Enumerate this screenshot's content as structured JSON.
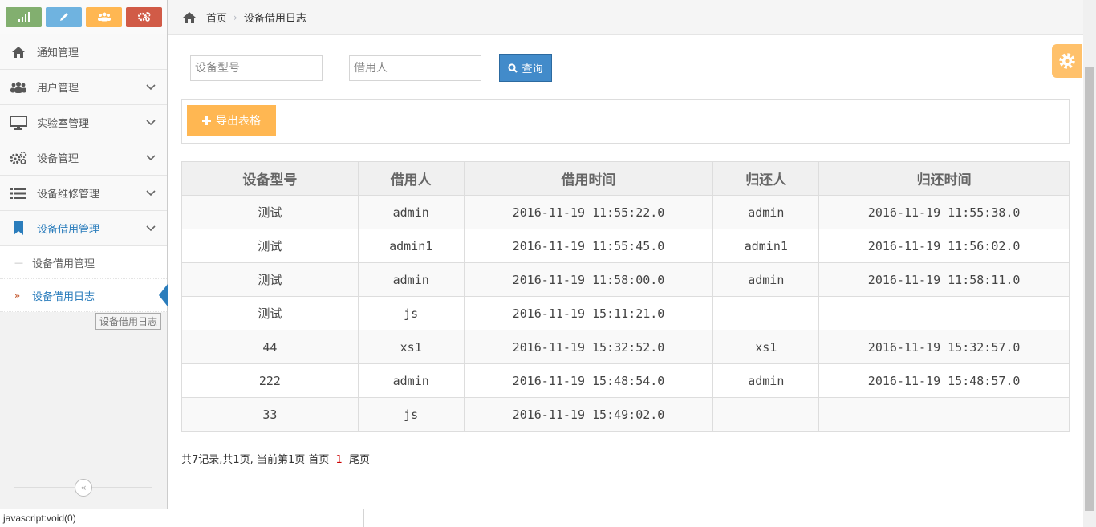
{
  "sidebar": {
    "shortcuts": [
      {
        "icon": "signal-icon",
        "color": "#82af6f"
      },
      {
        "icon": "pencil-icon",
        "color": "#6fb3e0"
      },
      {
        "icon": "users-icon",
        "color": "#ffb752"
      },
      {
        "icon": "cogs-icon",
        "color": "#d15b47"
      }
    ],
    "items": [
      {
        "label": "通知管理",
        "icon": "home-icon"
      },
      {
        "label": "用户管理",
        "icon": "users-icon"
      },
      {
        "label": "实验室管理",
        "icon": "desktop-icon"
      },
      {
        "label": "设备管理",
        "icon": "cogs-icon"
      },
      {
        "label": "设备维修管理",
        "icon": "list-icon"
      },
      {
        "label": "设备借用管理",
        "icon": "bookmark-icon"
      }
    ],
    "subitems": [
      {
        "label": "设备借用管理"
      },
      {
        "label": "设备借用日志"
      }
    ],
    "tooltip": "设备借用日志",
    "collapse_glyph": "«"
  },
  "breadcrumb": {
    "home": "首页",
    "current": "设备借用日志"
  },
  "search": {
    "model_placeholder": "设备型号",
    "borrower_placeholder": "借用人",
    "button_label": "查询"
  },
  "toolbar": {
    "export_label": "导出表格"
  },
  "table": {
    "headers": [
      "设备型号",
      "借用人",
      "借用时间",
      "归还人",
      "归还时间"
    ],
    "rows": [
      [
        "测试",
        "admin",
        "2016-11-19 11:55:22.0",
        "admin",
        "2016-11-19 11:55:38.0"
      ],
      [
        "测试",
        "admin1",
        "2016-11-19 11:55:45.0",
        "admin1",
        "2016-11-19 11:56:02.0"
      ],
      [
        "测试",
        "admin",
        "2016-11-19 11:58:00.0",
        "admin",
        "2016-11-19 11:58:11.0"
      ],
      [
        "测试",
        "js",
        "2016-11-19 15:11:21.0",
        "",
        ""
      ],
      [
        "44",
        "xs1",
        "2016-11-19 15:32:52.0",
        "xs1",
        "2016-11-19 15:32:57.0"
      ],
      [
        "222",
        "admin",
        "2016-11-19 15:48:54.0",
        "admin",
        "2016-11-19 15:48:57.0"
      ],
      [
        "33",
        "js",
        "2016-11-19 15:49:02.0",
        "",
        ""
      ]
    ]
  },
  "pager": {
    "summary": "共7记录,共1页, 当前第1页",
    "first": "首页",
    "current_page": "1",
    "last": "尾页"
  },
  "statusbar": {
    "text": "javascript:void(0)"
  },
  "colors": {
    "primary": "#428bca",
    "warning": "#ffb752",
    "accent": "#2b7dbc"
  }
}
